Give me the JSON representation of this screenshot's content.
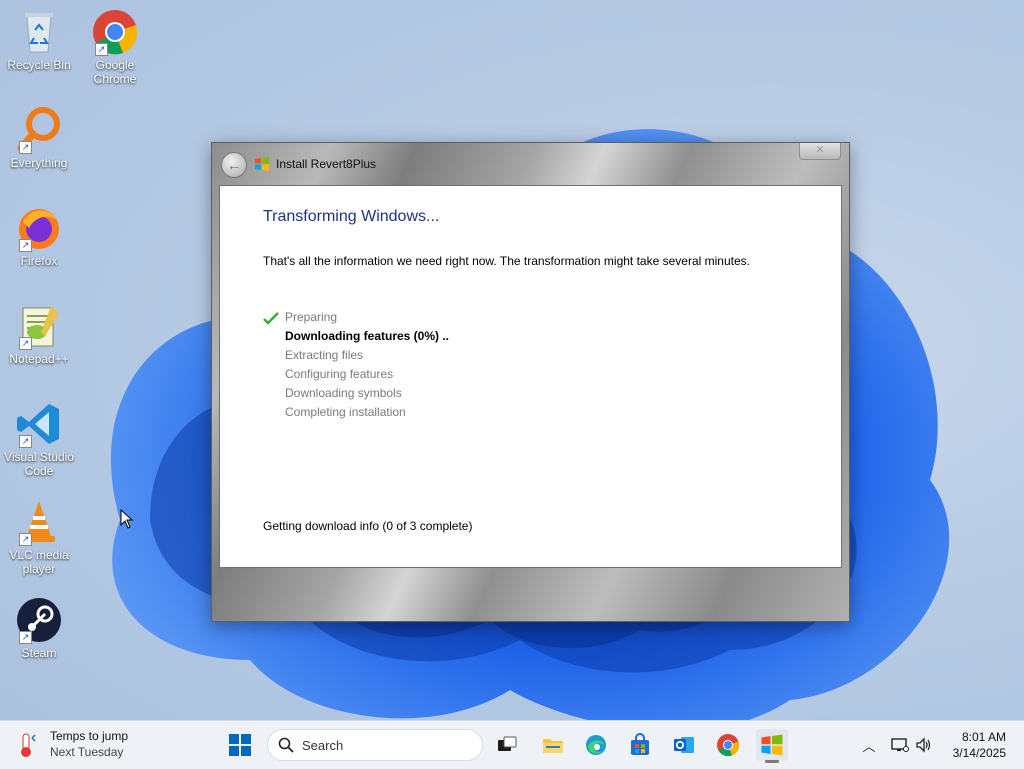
{
  "desktop": {
    "icons": [
      {
        "label": "Recycle Bin",
        "icon": "recycle-bin-icon"
      },
      {
        "label": "Google Chrome",
        "icon": "chrome-icon"
      },
      {
        "label": "Everything",
        "icon": "everything-icon"
      },
      {
        "label": "Firefox",
        "icon": "firefox-icon"
      },
      {
        "label": "Notepad++",
        "icon": "notepadpp-icon"
      },
      {
        "label": "Visual Studio Code",
        "icon": "vscode-icon"
      },
      {
        "label": "VLC media player",
        "icon": "vlc-icon"
      },
      {
        "label": "Steam",
        "icon": "steam-icon"
      }
    ]
  },
  "window": {
    "title": "Install Revert8Plus",
    "heading": "Transforming Windows...",
    "info": "That's all the information we need right now. The transformation might take several minutes.",
    "steps": [
      {
        "label": "Preparing",
        "state": "done"
      },
      {
        "label": "Downloading features (0%) ..",
        "state": "active"
      },
      {
        "label": "Extracting files",
        "state": "pending"
      },
      {
        "label": "Configuring features",
        "state": "pending"
      },
      {
        "label": "Downloading symbols",
        "state": "pending"
      },
      {
        "label": "Completing installation",
        "state": "pending"
      }
    ],
    "status": "Getting download info (0 of 3 complete)"
  },
  "taskbar": {
    "weather_line1": "Temps to jump",
    "weather_line2": "Next Tuesday",
    "search_placeholder": "Search",
    "time": "8:01 AM",
    "date": "3/14/2025"
  },
  "colors": {
    "heading": "#1e3287",
    "accent": "#0067c0"
  }
}
